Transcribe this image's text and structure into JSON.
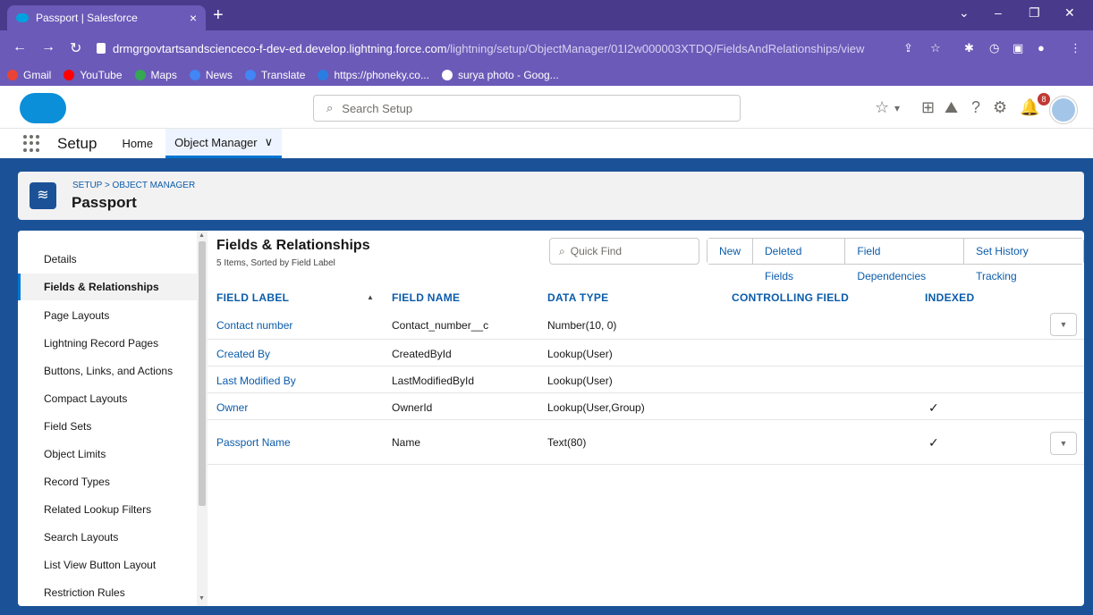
{
  "browser": {
    "tab_title": "Passport | Salesforce",
    "tab_close": "×",
    "new_tab": "+",
    "url_host": "drmgrgovtartsandscienceco-f-dev-ed.develop.lightning.force.com",
    "url_path": "/lightning/setup/ObjectManager/01I2w000003XTDQ/FieldsAndRelationships/view",
    "bookmarks": [
      {
        "label": "Gmail",
        "color": "#ea4335"
      },
      {
        "label": "YouTube",
        "color": "#ff0000"
      },
      {
        "label": "Maps",
        "color": "#34a853"
      },
      {
        "label": "News",
        "color": "#4285f4"
      },
      {
        "label": "Translate",
        "color": "#4285f4"
      },
      {
        "label": "https://phoneky.co...",
        "color": "#2a7de1"
      },
      {
        "label": "surya photo - Goog...",
        "color": "#ffffff"
      }
    ]
  },
  "header": {
    "search_placeholder": "Search Setup",
    "notification_count": "8"
  },
  "appnav": {
    "app_name": "Setup",
    "home": "Home",
    "object_manager": "Object Manager",
    "chevron": "∨"
  },
  "object": {
    "breadcrumb": "SETUP > OBJECT MANAGER",
    "name": "Passport"
  },
  "sidebar": {
    "items": [
      "Details",
      "Fields & Relationships",
      "Page Layouts",
      "Lightning Record Pages",
      "Buttons, Links, and Actions",
      "Compact Layouts",
      "Field Sets",
      "Object Limits",
      "Record Types",
      "Related Lookup Filters",
      "Search Layouts",
      "List View Button Layout",
      "Restriction Rules"
    ],
    "active_index": 1
  },
  "fields": {
    "title": "Fields & Relationships",
    "subtitle": "5 Items, Sorted by Field Label",
    "quick_find_placeholder": "Quick Find",
    "buttons": [
      "New",
      "Deleted Fields",
      "Field Dependencies",
      "Set History Tracking"
    ],
    "columns": [
      "FIELD LABEL",
      "FIELD NAME",
      "DATA TYPE",
      "CONTROLLING FIELD",
      "INDEXED"
    ],
    "rows": [
      {
        "label": "Contact number",
        "name": "Contact_number__c",
        "type": "Number(10, 0)",
        "controlling": "",
        "indexed": false,
        "menu": true
      },
      {
        "label": "Created By",
        "name": "CreatedById",
        "type": "Lookup(User)",
        "controlling": "",
        "indexed": false,
        "menu": false
      },
      {
        "label": "Last Modified By",
        "name": "LastModifiedById",
        "type": "Lookup(User)",
        "controlling": "",
        "indexed": false,
        "menu": false
      },
      {
        "label": "Owner",
        "name": "OwnerId",
        "type": "Lookup(User,Group)",
        "controlling": "",
        "indexed": true,
        "menu": false
      },
      {
        "label": "Passport Name",
        "name": "Name",
        "type": "Text(80)",
        "controlling": "",
        "indexed": true,
        "menu": true
      }
    ]
  }
}
